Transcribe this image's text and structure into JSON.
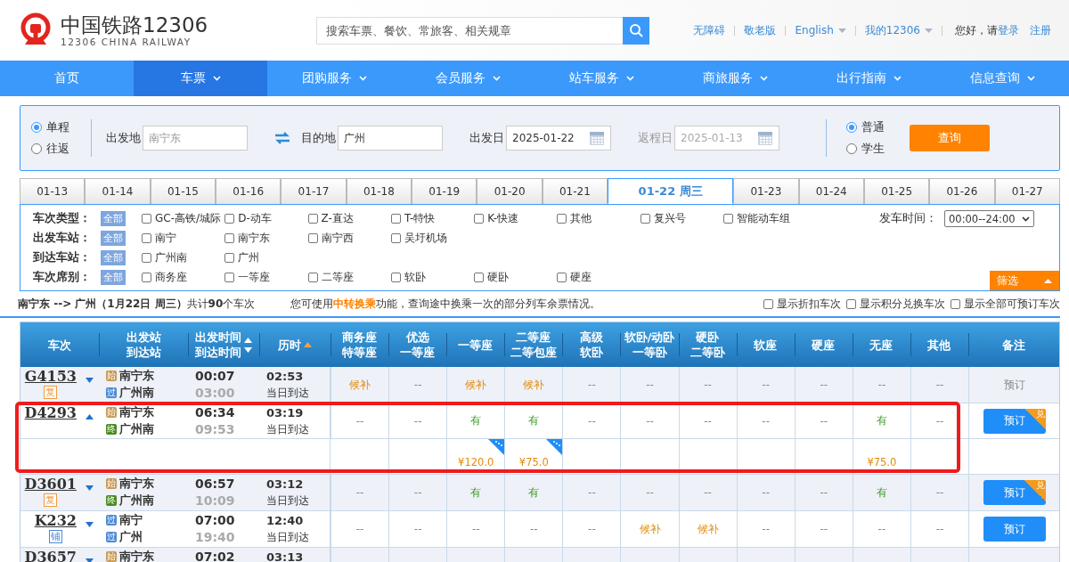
{
  "header": {
    "logo_title": "中国铁路12306",
    "logo_subtitle": "12306 CHINA RAILWAY",
    "search": {
      "placeholder": "搜索车票、餐饮、常旅客、相关规章"
    },
    "links": [
      {
        "label": "无障碍",
        "dropdown": false
      },
      {
        "label": "敬老版",
        "dropdown": false
      },
      {
        "label": "English",
        "dropdown": true
      },
      {
        "label": "我的12306",
        "dropdown": true
      }
    ],
    "greeting": "您好，请",
    "login": "登录",
    "register": "注册"
  },
  "nav": [
    {
      "label": "首页",
      "dropdown": false,
      "selected": false
    },
    {
      "label": "车票",
      "dropdown": true,
      "selected": true
    },
    {
      "label": "团购服务",
      "dropdown": true,
      "selected": false
    },
    {
      "label": "会员服务",
      "dropdown": true,
      "selected": false
    },
    {
      "label": "站车服务",
      "dropdown": true,
      "selected": false
    },
    {
      "label": "商旅服务",
      "dropdown": true,
      "selected": false
    },
    {
      "label": "出行指南",
      "dropdown": true,
      "selected": false
    },
    {
      "label": "信息查询",
      "dropdown": true,
      "selected": false
    }
  ],
  "query": {
    "trip_types": [
      {
        "label": "单程",
        "selected": true
      },
      {
        "label": "往返",
        "selected": false
      }
    ],
    "from": {
      "label": "出发地",
      "value": "南宁东"
    },
    "to": {
      "label": "目的地",
      "value": "广州"
    },
    "depart_date": {
      "label": "出发日",
      "value": "2025-01-22",
      "disabled": false
    },
    "return_date": {
      "label": "返程日",
      "value": "2025-01-13",
      "disabled": true
    },
    "passenger_types": [
      {
        "label": "普通",
        "selected": true
      },
      {
        "label": "学生",
        "selected": false
      }
    ],
    "submit": "查询"
  },
  "date_tabs": [
    {
      "label": "01-13",
      "selected": false
    },
    {
      "label": "01-14",
      "selected": false
    },
    {
      "label": "01-15",
      "selected": false
    },
    {
      "label": "01-16",
      "selected": false
    },
    {
      "label": "01-17",
      "selected": false
    },
    {
      "label": "01-18",
      "selected": false
    },
    {
      "label": "01-19",
      "selected": false
    },
    {
      "label": "01-20",
      "selected": false
    },
    {
      "label": "01-21",
      "selected": false
    },
    {
      "label": "01-22 周三",
      "selected": true
    },
    {
      "label": "01-23",
      "selected": false
    },
    {
      "label": "01-24",
      "selected": false
    },
    {
      "label": "01-25",
      "selected": false
    },
    {
      "label": "01-26",
      "selected": false
    },
    {
      "label": "01-27",
      "selected": false
    }
  ],
  "filters": [
    {
      "label": "车次类型：",
      "all": "全部",
      "options": [
        {
          "label": "GC-高铁/城际",
          "checked": false
        },
        {
          "label": "D-动车",
          "checked": false
        },
        {
          "label": "Z-直达",
          "checked": false
        },
        {
          "label": "T-特快",
          "checked": false
        },
        {
          "label": "K-快速",
          "checked": false
        },
        {
          "label": "其他",
          "checked": false
        },
        {
          "label": "复兴号",
          "checked": false
        },
        {
          "label": "智能动车组",
          "checked": false
        }
      ]
    },
    {
      "label": "出发车站：",
      "all": "全部",
      "options": [
        {
          "label": "南宁",
          "checked": false
        },
        {
          "label": "南宁东",
          "checked": false
        },
        {
          "label": "南宁西",
          "checked": false
        },
        {
          "label": "吴圩机场",
          "checked": false
        }
      ]
    },
    {
      "label": "到达车站：",
      "all": "全部",
      "options": [
        {
          "label": "广州南",
          "checked": false
        },
        {
          "label": "广州",
          "checked": false
        }
      ]
    },
    {
      "label": "车次席别：",
      "all": "全部",
      "options": [
        {
          "label": "商务座",
          "checked": false
        },
        {
          "label": "一等座",
          "checked": false
        },
        {
          "label": "二等座",
          "checked": false
        },
        {
          "label": "软卧",
          "checked": false
        },
        {
          "label": "硬卧",
          "checked": false
        },
        {
          "label": "硬座",
          "checked": false
        }
      ]
    }
  ],
  "depart_time": {
    "label": "发车时间：",
    "value": "00:00--24:00"
  },
  "filter_button": "筛选",
  "summary": "**南宁东 --> 广州（1月22日  周三）**共计**90**个车次",
  "transfer_note": {
    "before": "您可使用",
    "link": "中转换乘",
    "after": "功能，查询途中换乘一次的部分列车余票情况。"
  },
  "display_options": [
    {
      "label": "显示折扣车次",
      "checked": false
    },
    {
      "label": "显示积分兑换车次",
      "checked": false
    },
    {
      "label": "显示全部可预订车次",
      "checked": false
    }
  ],
  "table": {
    "columns": [
      {
        "label": "车次"
      },
      {
        "label": "出发站",
        "label2": "到达站"
      },
      {
        "label": "出发时间",
        "label2": "到达时间",
        "sort_up": true,
        "sort_down": true
      },
      {
        "label": "历时",
        "sort_up": true,
        "sorted": true
      },
      {
        "label": "商务座",
        "label2": "特等座"
      },
      {
        "label": "优选",
        "label2": "一等座"
      },
      {
        "label": "一等座"
      },
      {
        "label": "二等座",
        "label2": "二等包座"
      },
      {
        "label": "高级",
        "label2": "软卧"
      },
      {
        "label": "软卧/动卧",
        "label2": "一等卧"
      },
      {
        "label": "硬卧",
        "label2": "二等卧"
      },
      {
        "label": "软座"
      },
      {
        "label": "硬座"
      },
      {
        "label": "无座"
      },
      {
        "label": "其他"
      },
      {
        "label": "备注"
      }
    ],
    "rows": [
      {
        "train": "G4153",
        "expanded": false,
        "badge": {
          "text": "复",
          "kind": "fuxing"
        },
        "from": {
          "tag": {
            "text": "始",
            "kind": "start"
          },
          "station": "南宁东"
        },
        "to": {
          "tag": {
            "text": "过",
            "kind": "pass"
          },
          "station": "广州南"
        },
        "depart": "00:07",
        "arrive": "03:00",
        "duration": "02:53",
        "arrival_day": "当日到达",
        "seats": [
          {
            "text": "候补",
            "kind": "wait"
          },
          {
            "text": "--",
            "kind": "none"
          },
          {
            "text": "候补",
            "kind": "wait"
          },
          {
            "text": "候补",
            "kind": "wait"
          },
          {
            "text": "--",
            "kind": "none"
          },
          {
            "text": "--",
            "kind": "none"
          },
          {
            "text": "--",
            "kind": "none"
          },
          {
            "text": "--",
            "kind": "none"
          },
          {
            "text": "--",
            "kind": "none"
          },
          {
            "text": "--",
            "kind": "none"
          },
          {
            "text": "--",
            "kind": "none"
          }
        ],
        "booking": {
          "label": "预订",
          "kind": "text"
        }
      },
      {
        "train": "D4293",
        "expanded": true,
        "highlighted": true,
        "from": {
          "tag": {
            "text": "始",
            "kind": "start"
          },
          "station": "南宁东"
        },
        "to": {
          "tag": {
            "text": "终",
            "kind": "end"
          },
          "station": "广州南"
        },
        "depart": "06:34",
        "arrive": "09:53",
        "duration": "03:19",
        "arrival_day": "当日到达",
        "seats": [
          {
            "text": "--",
            "kind": "none"
          },
          {
            "text": "--",
            "kind": "none"
          },
          {
            "text": "有",
            "kind": "yes",
            "price": "¥120.0",
            "discount": true
          },
          {
            "text": "有",
            "kind": "yes",
            "price": "¥75.0",
            "discount": true
          },
          {
            "text": "--",
            "kind": "none"
          },
          {
            "text": "--",
            "kind": "none"
          },
          {
            "text": "--",
            "kind": "none"
          },
          {
            "text": "--",
            "kind": "none"
          },
          {
            "text": "--",
            "kind": "none"
          },
          {
            "text": "有",
            "kind": "yes",
            "price": "¥75.0"
          },
          {
            "text": "--",
            "kind": "none"
          }
        ],
        "booking": {
          "label": "预订",
          "kind": "button",
          "corner": "兑"
        }
      },
      {
        "train": "D3601",
        "expanded": false,
        "badge": {
          "text": "复",
          "kind": "fuxing"
        },
        "from": {
          "tag": {
            "text": "始",
            "kind": "start"
          },
          "station": "南宁东"
        },
        "to": {
          "tag": {
            "text": "终",
            "kind": "end"
          },
          "station": "广州南"
        },
        "depart": "06:57",
        "arrive": "10:09",
        "duration": "03:12",
        "arrival_day": "当日到达",
        "seats": [
          {
            "text": "--",
            "kind": "none"
          },
          {
            "text": "--",
            "kind": "none"
          },
          {
            "text": "有",
            "kind": "yes"
          },
          {
            "text": "有",
            "kind": "yes"
          },
          {
            "text": "--",
            "kind": "none"
          },
          {
            "text": "--",
            "kind": "none"
          },
          {
            "text": "--",
            "kind": "none"
          },
          {
            "text": "--",
            "kind": "none"
          },
          {
            "text": "--",
            "kind": "none"
          },
          {
            "text": "有",
            "kind": "yes"
          },
          {
            "text": "--",
            "kind": "none"
          }
        ],
        "booking": {
          "label": "预订",
          "kind": "button",
          "corner": "兑"
        }
      },
      {
        "train": "K232",
        "expanded": false,
        "badge": {
          "text": "铺",
          "kind": "berth"
        },
        "from": {
          "tag": {
            "text": "过",
            "kind": "pass"
          },
          "station": "南宁"
        },
        "to": {
          "tag": {
            "text": "过",
            "kind": "pass"
          },
          "station": "广州"
        },
        "depart": "07:00",
        "arrive": "19:40",
        "duration": "12:40",
        "arrival_day": "当日到达",
        "seats": [
          {
            "text": "--",
            "kind": "none"
          },
          {
            "text": "--",
            "kind": "none"
          },
          {
            "text": "--",
            "kind": "none"
          },
          {
            "text": "--",
            "kind": "none"
          },
          {
            "text": "--",
            "kind": "none"
          },
          {
            "text": "候补",
            "kind": "wait"
          },
          {
            "text": "候补",
            "kind": "wait"
          },
          {
            "text": "--",
            "kind": "none"
          },
          {
            "text": "--",
            "kind": "none"
          },
          {
            "text": "--",
            "kind": "none"
          },
          {
            "text": "--",
            "kind": "none"
          }
        ],
        "booking": {
          "label": "预订",
          "kind": "button"
        }
      },
      {
        "train": "D3657",
        "expanded": false,
        "from": {
          "tag": {
            "text": "始",
            "kind": "start"
          },
          "station": "南宁东"
        },
        "depart": "07:02",
        "duration": "03:13"
      }
    ]
  }
}
